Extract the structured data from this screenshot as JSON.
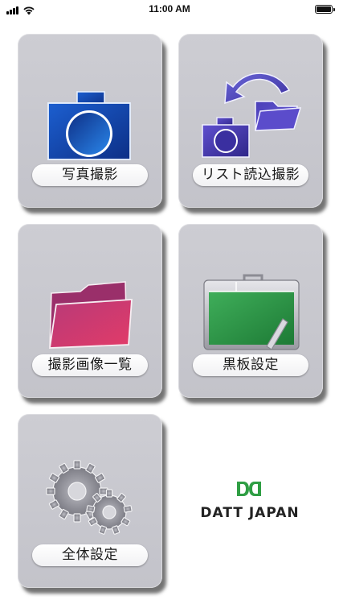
{
  "status_bar": {
    "time": "11:00 AM",
    "icons": [
      "cellular-signal-icon",
      "wifi-icon",
      "battery-icon"
    ]
  },
  "menu": {
    "photo_capture": {
      "label": "写真撮影",
      "icon": "camera-icon"
    },
    "list_read_capture": {
      "label": "リスト読込撮影",
      "icon": "folder-to-camera-icon"
    },
    "captured_images": {
      "label": "撮影画像一覧",
      "icon": "folder-icon"
    },
    "blackboard_settings": {
      "label": "黒板設定",
      "icon": "blackboard-icon"
    },
    "general_settings": {
      "label": "全体設定",
      "icon": "gears-icon"
    }
  },
  "brand": {
    "name": "DATT JAPAN",
    "mark_color": "#2f9e44"
  }
}
